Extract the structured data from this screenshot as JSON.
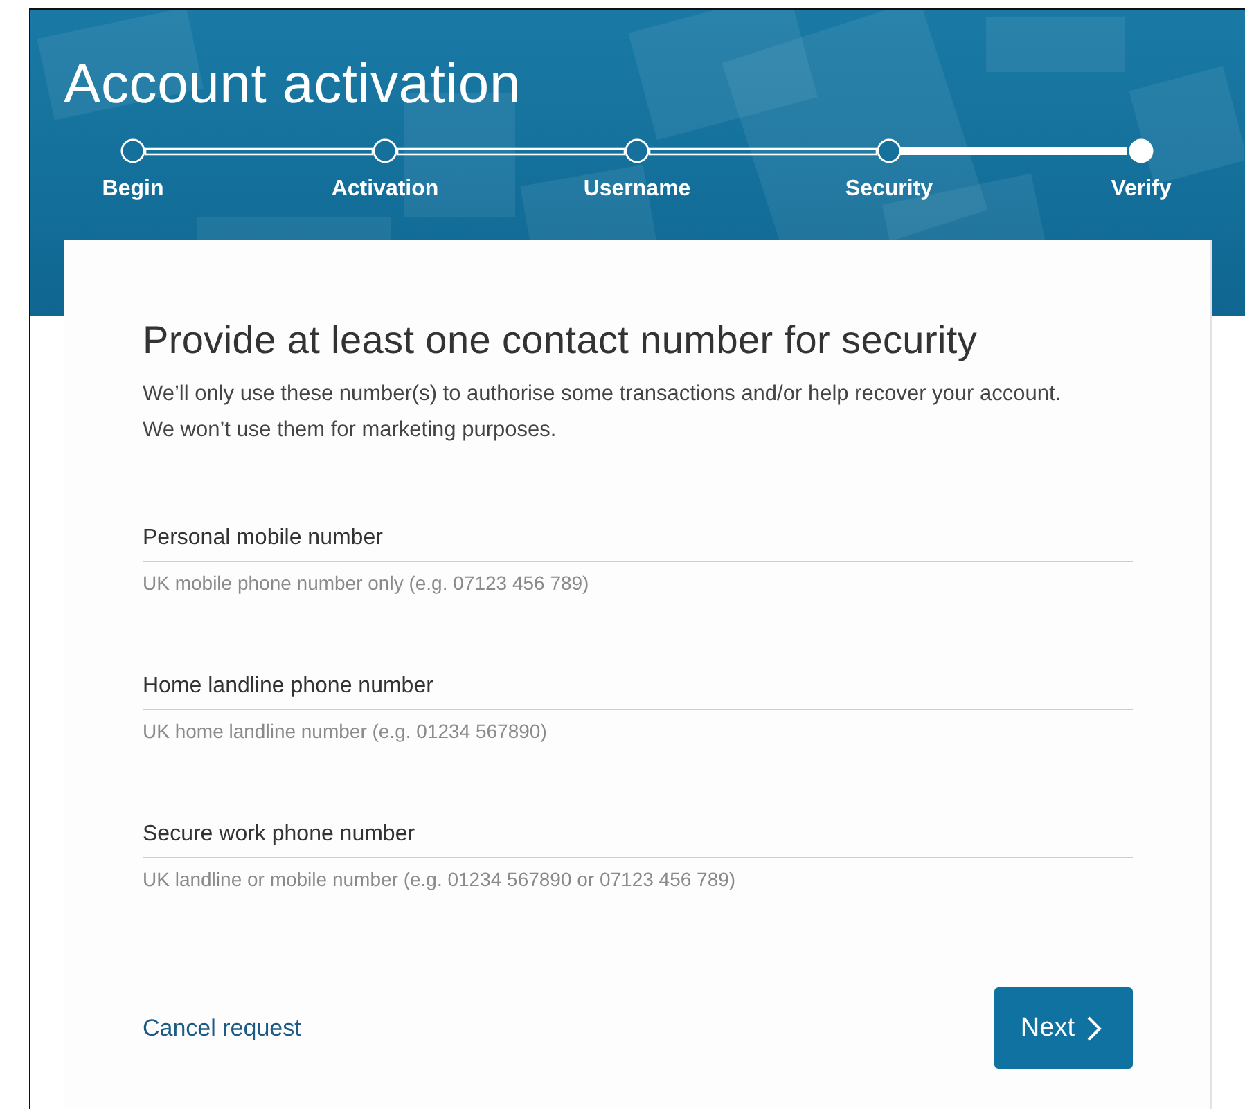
{
  "header": {
    "title": "Account activation"
  },
  "steps": [
    {
      "label": "Begin",
      "selected": false
    },
    {
      "label": "Activation",
      "selected": false
    },
    {
      "label": "Username",
      "selected": false
    },
    {
      "label": "Security",
      "selected": false
    },
    {
      "label": "Verify",
      "selected": true
    }
  ],
  "form": {
    "heading": "Provide at least one contact number for security",
    "intro": "We’ll only use these number(s) to authorise some transactions and/or help recover your account. We won’t use them for marketing purposes.",
    "fields": [
      {
        "label": "Personal mobile number",
        "placeholder": "UK mobile phone number only (e.g. 07123 456 789)"
      },
      {
        "label": "Home landline phone number",
        "placeholder": "UK home landline number (e.g. 01234 567890)"
      },
      {
        "label": "Secure work phone number",
        "placeholder": "UK landline or mobile number (e.g. 01234 567890 or 07123 456 789)"
      }
    ],
    "cancel_link": "Cancel request",
    "next_button": "Next"
  }
}
